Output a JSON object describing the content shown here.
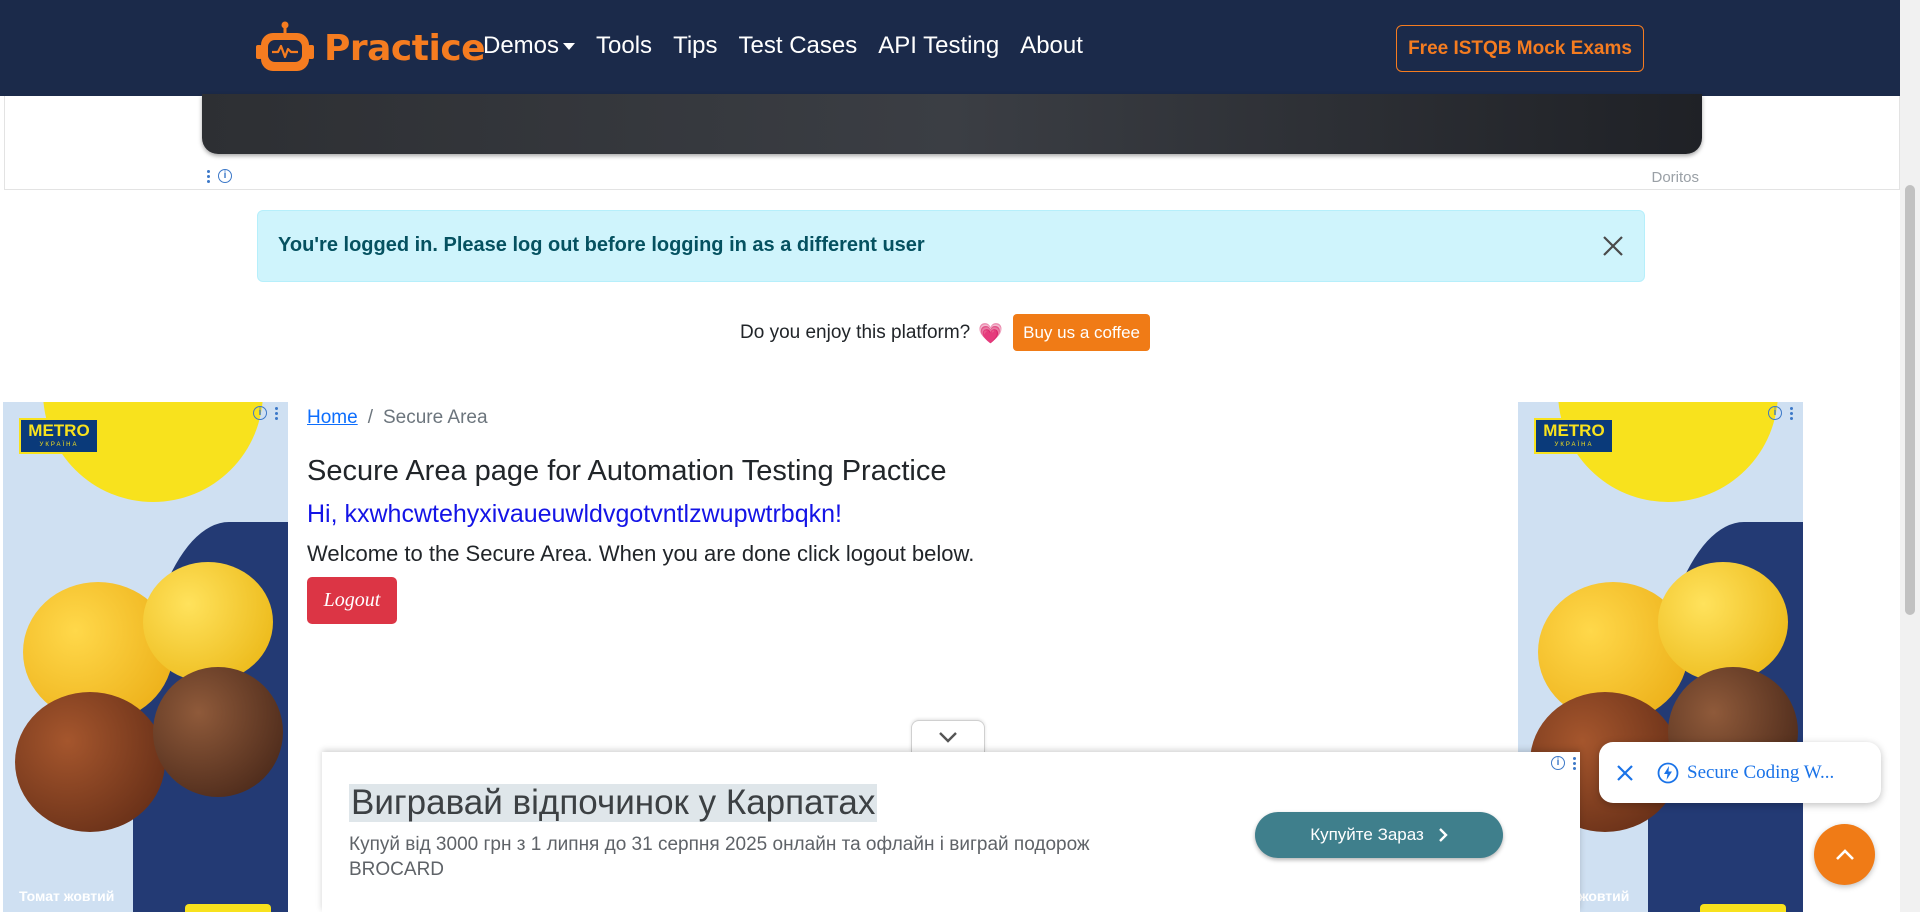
{
  "navbar": {
    "brand": "Practice",
    "links": [
      {
        "label": "Demos"
      },
      {
        "label": "Tools"
      },
      {
        "label": "Tips"
      },
      {
        "label": "Test Cases"
      },
      {
        "label": "API Testing"
      },
      {
        "label": "About"
      }
    ],
    "cta": "Free ISTQB Mock Exams"
  },
  "top_ad": {
    "advertiser": "Doritos"
  },
  "alert": {
    "message": "You're logged in. Please log out before logging in as a different user"
  },
  "coffee": {
    "question": "Do you enjoy this platform?",
    "heart": "💗",
    "button": "Buy us a coffee"
  },
  "breadcrumb": {
    "home": "Home",
    "separator": "/",
    "current": "Secure Area"
  },
  "main": {
    "title": "Secure Area page for Automation Testing Practice",
    "greeting": "Hi, kxwhcwtehyxivaueuwldvgotvntlzwupwtrbqkn!",
    "welcome": "Welcome to the Secure Area. When you are done click logout below.",
    "logout": "Logout"
  },
  "side_ads": {
    "brand": "METRO",
    "brand_sub": "УКРАЇНА",
    "caption": "Томат жовтий"
  },
  "bottom_ad": {
    "title": "Вигравай відпочинок у Карпатах",
    "description": "Купуй від 3000 грн з 1 липня до 31 серпня 2025 онлайн та офлайн і виграй подорож BROCARD",
    "cta": "Купуйте Зараз"
  },
  "chat": {
    "label": "Secure Coding W..."
  },
  "colors": {
    "navbar": "#1b2a4a",
    "accent": "#f57c20",
    "alert_bg": "#cff4fc",
    "logout": "#dc3545",
    "link": "#0d6efd"
  }
}
